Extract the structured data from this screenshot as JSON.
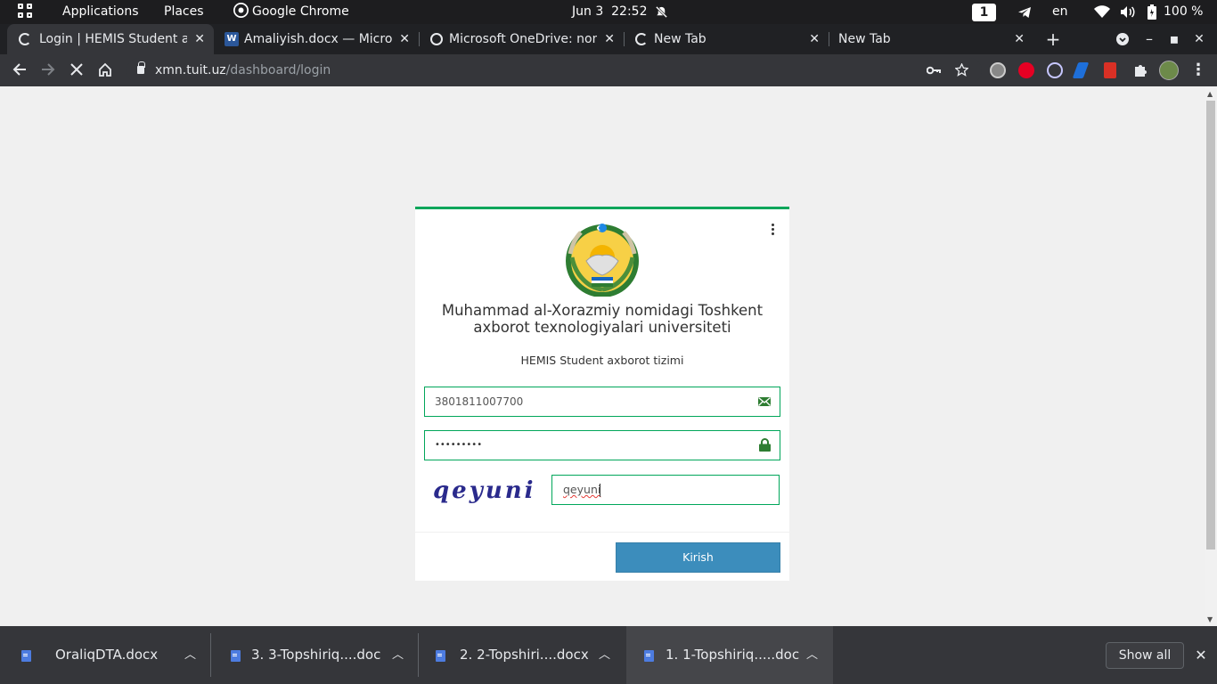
{
  "topbar": {
    "applications": "Applications",
    "places": "Places",
    "app_name": "Google Chrome",
    "date": "Jun 3",
    "time": "22:52",
    "workspace": "1",
    "keyboard_layout": "en",
    "battery": "100 %"
  },
  "tabs": [
    {
      "title": "Login | HEMIS Student ax",
      "active": true,
      "favicon": "loading-spinner-icon"
    },
    {
      "title": "Amaliyish.docx — Micro",
      "active": false,
      "favicon": "word-icon"
    },
    {
      "title": "Microsoft OneDrive: nom",
      "active": false,
      "favicon": "globe-icon"
    },
    {
      "title": "New Tab",
      "active": false,
      "favicon": "loading-spinner-icon"
    },
    {
      "title": "New Tab",
      "active": false,
      "favicon": "none"
    }
  ],
  "omnibox": {
    "host": "xmn.tuit.uz",
    "path": "/dashboard/login"
  },
  "login": {
    "university": "Muhammad al-Xorazmiy nomidagi Toshkent axborot texnologiyalari universiteti",
    "system": "HEMIS Student axborot tizimi",
    "login_value": "3801811007700",
    "password_mask": "•••••••••",
    "captcha_image_text": "qeyuni",
    "captcha_value": "qeyuni",
    "submit_label": "Kirish",
    "accent_color": "#00a65a",
    "button_color": "#3c8dbc"
  },
  "downloads": {
    "items": [
      {
        "name": "OraliqDTA.docx"
      },
      {
        "name": "3. 3-Topshiriq....doc"
      },
      {
        "name": "2. 2-Topshiri....docx"
      },
      {
        "name": "1. 1-Topshiriq.....doc"
      }
    ],
    "show_all": "Show all"
  }
}
